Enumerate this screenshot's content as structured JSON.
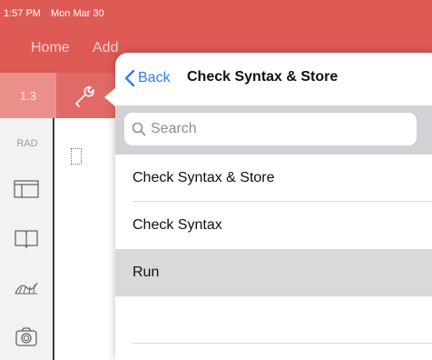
{
  "status_bar": {
    "time": "1:57 PM",
    "date": "Mon Mar 30"
  },
  "menu": {
    "home": "Home",
    "add": "Add"
  },
  "tab": {
    "page_number": "1.3"
  },
  "sidebar": {
    "angle_mode": "RAD",
    "icons": [
      "layout-icon",
      "book-icon",
      "graph-icon",
      "camera-icon"
    ]
  },
  "popover": {
    "back_label": "Back",
    "title": "Check Syntax & Store",
    "search_placeholder": "Search",
    "items": [
      {
        "label": "Check Syntax & Store",
        "selected": false
      },
      {
        "label": "Check Syntax",
        "selected": false
      },
      {
        "label": "Run",
        "selected": true
      },
      {
        "label": "",
        "selected": false
      }
    ]
  },
  "colors": {
    "accent": "#de5a55",
    "link": "#2f7bf6",
    "selected_row": "#d9d9d9"
  }
}
